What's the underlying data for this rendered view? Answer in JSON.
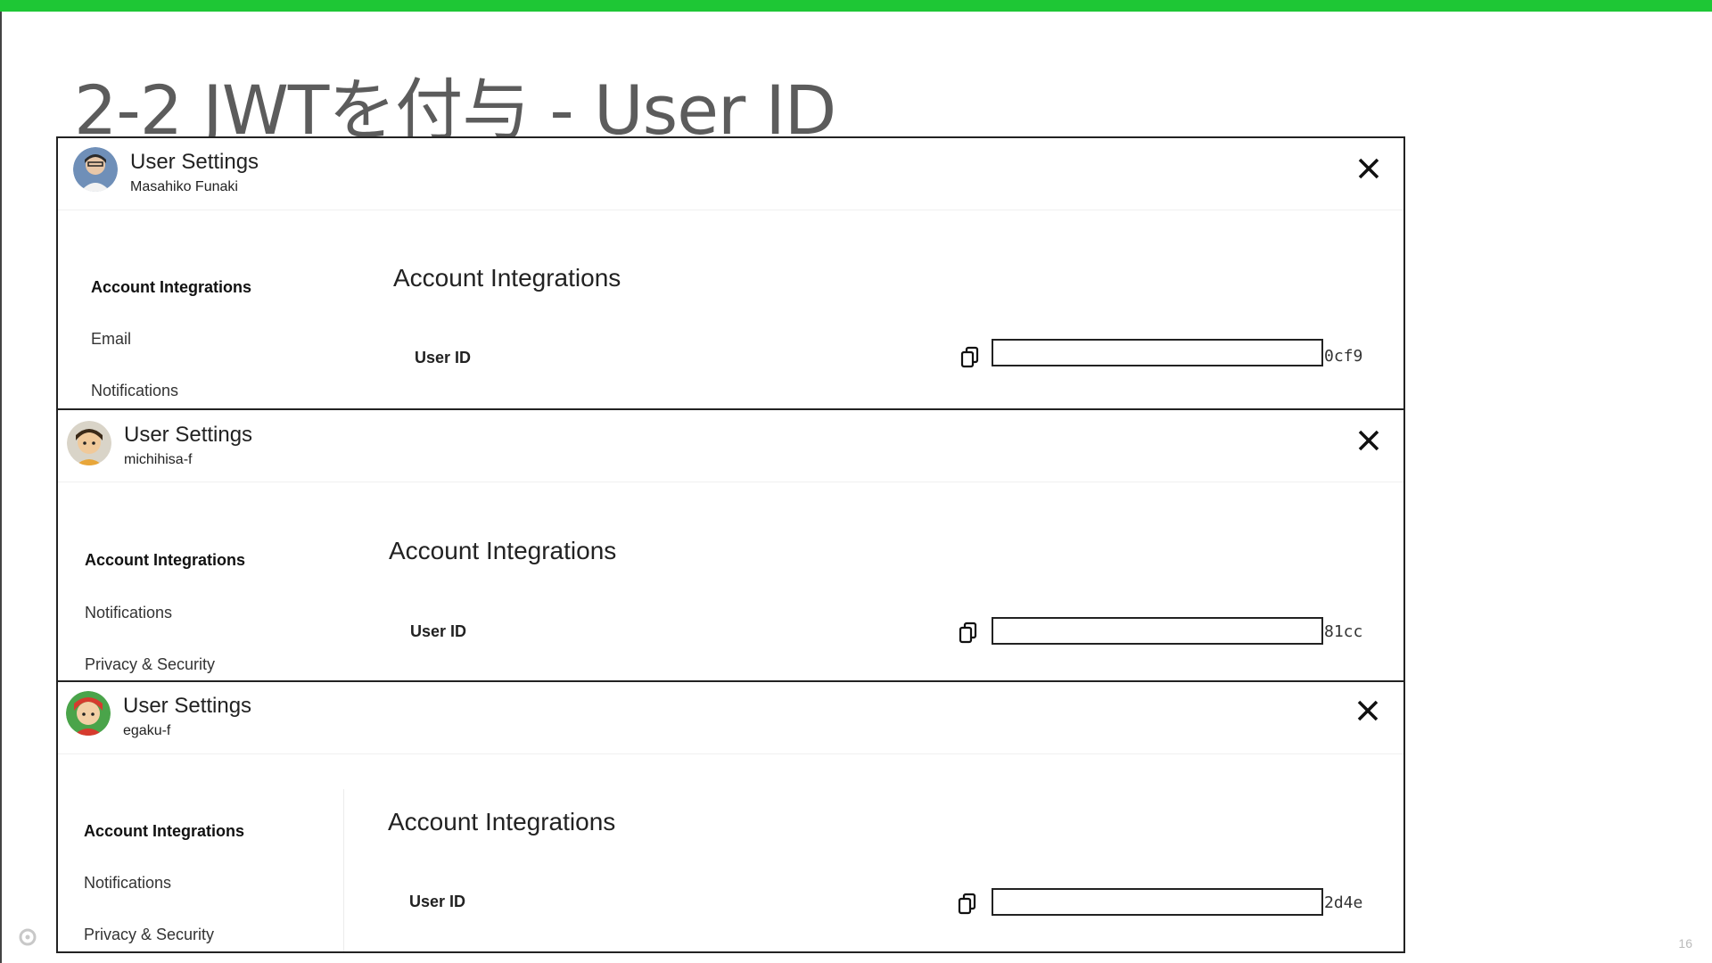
{
  "slide": {
    "title": "2-2 JWTを付与 - User ID",
    "page_number": "16",
    "accent_color": "#1ec735"
  },
  "panels": [
    {
      "header_title": "User Settings",
      "username": "Masahiko Funaki",
      "sidebar": [
        "Account Integrations",
        "Email",
        "Notifications"
      ],
      "section_title": "Account Integrations",
      "field_label": "User ID",
      "user_id_suffix": "0cf9",
      "avatar_icon": "user-avatar"
    },
    {
      "header_title": "User Settings",
      "username": "michihisa-f",
      "sidebar": [
        "Account Integrations",
        "Notifications",
        "Privacy & Security"
      ],
      "section_title": "Account Integrations",
      "field_label": "User ID",
      "user_id_suffix": "81cc",
      "avatar_icon": "user-avatar"
    },
    {
      "header_title": "User Settings",
      "username": "egaku-f",
      "sidebar": [
        "Account Integrations",
        "Notifications",
        "Privacy & Security"
      ],
      "section_title": "Account Integrations",
      "field_label": "User ID",
      "user_id_suffix": "2d4e",
      "avatar_icon": "user-avatar"
    }
  ]
}
